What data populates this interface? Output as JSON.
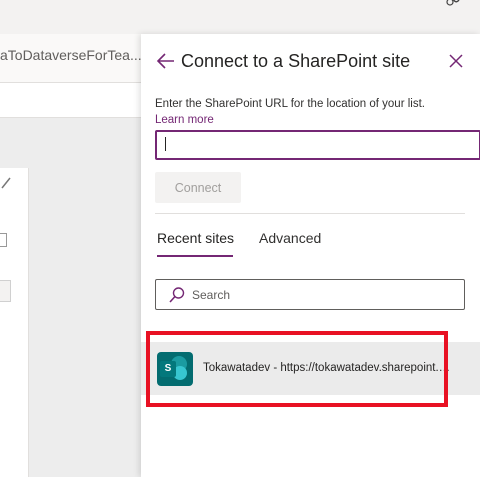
{
  "background": {
    "app_title": "aToDataverseForTea..."
  },
  "panel": {
    "title": "Connect to a SharePoint site",
    "instruction": "Enter the SharePoint URL for the location of your list.",
    "learn_more": "Learn more",
    "url_input": {
      "value": "",
      "placeholder": ""
    },
    "connect_label": "Connect",
    "tabs": [
      {
        "label": "Recent sites",
        "selected": true
      },
      {
        "label": "Advanced",
        "selected": false
      }
    ],
    "search": {
      "placeholder": "Search"
    },
    "recent_sites": [
      {
        "label": "Tokawatadev - https://tokawatadev.sharepoint.com/sites/Tokawatadev",
        "icon": "sharepoint-icon"
      }
    ]
  },
  "colors": {
    "accent": "#742774",
    "highlight": "#e81123",
    "sharepoint": "#036c70"
  }
}
